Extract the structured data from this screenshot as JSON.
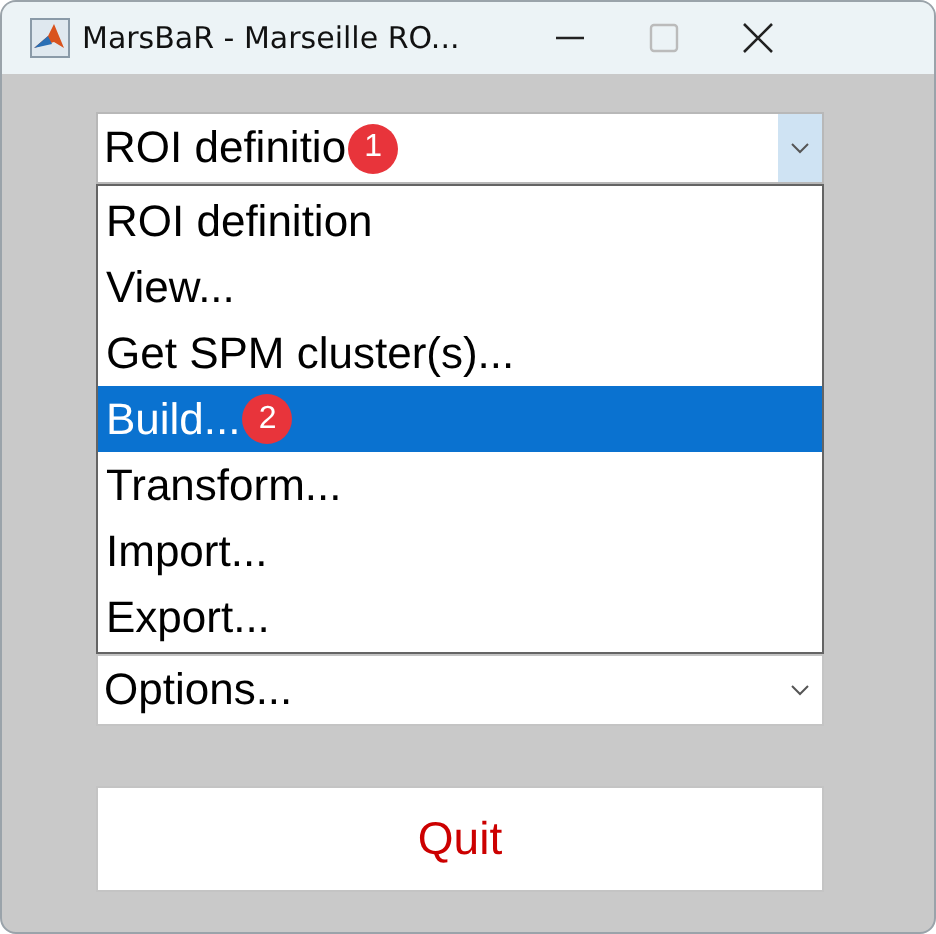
{
  "window": {
    "title": "MarsBaR - Marseille RO..."
  },
  "roi_menu": {
    "value": "ROI definitio",
    "badge": "1"
  },
  "dropdown_items": [
    {
      "label": "ROI definition",
      "selected": false
    },
    {
      "label": "View...",
      "selected": false
    },
    {
      "label": "Get SPM cluster(s)...",
      "selected": false
    },
    {
      "label": "Build...",
      "selected": true,
      "badge": "2"
    },
    {
      "label": "Transform...",
      "selected": false
    },
    {
      "label": "Import...",
      "selected": false
    },
    {
      "label": "Export...",
      "selected": false
    }
  ],
  "options_menu": {
    "value": "Options..."
  },
  "quit_button": {
    "label": "Quit"
  }
}
